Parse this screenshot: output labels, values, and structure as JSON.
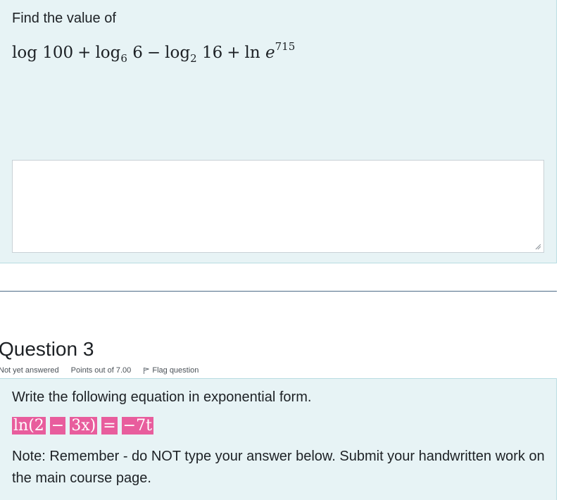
{
  "question2": {
    "prompt": "Find the value of",
    "expression": {
      "t1_fn": "log",
      "t1_arg": "100",
      "op1": "+",
      "t2_fn": "log",
      "t2_base": "6",
      "t2_arg": "6",
      "op2": "−",
      "t3_fn": "log",
      "t3_base": "2",
      "t3_arg": "16",
      "op3": "+",
      "t4_fn": "ln",
      "t4_arg": "e",
      "t4_exp": "715"
    },
    "answer_value": ""
  },
  "question3": {
    "title": "Question 3",
    "status": "Not yet answered",
    "points": "Points out of 7.00",
    "flag_label": "Flag question",
    "prompt": "Write the following equation in exponential form.",
    "equation": {
      "part1": "ln(2",
      "part2": "−",
      "part3": "3x)",
      "part4": "=",
      "part5": "−7t"
    },
    "note": "Note: Remember - do NOT type your answer below. Submit your handwritten work on the main course page."
  },
  "colors": {
    "question_bg": "#e7f3f5",
    "highlight": "#e85d9d",
    "divider": "#4d6b86"
  },
  "icons": {
    "flag": "flag-icon",
    "resize": "resize-grip-icon"
  }
}
